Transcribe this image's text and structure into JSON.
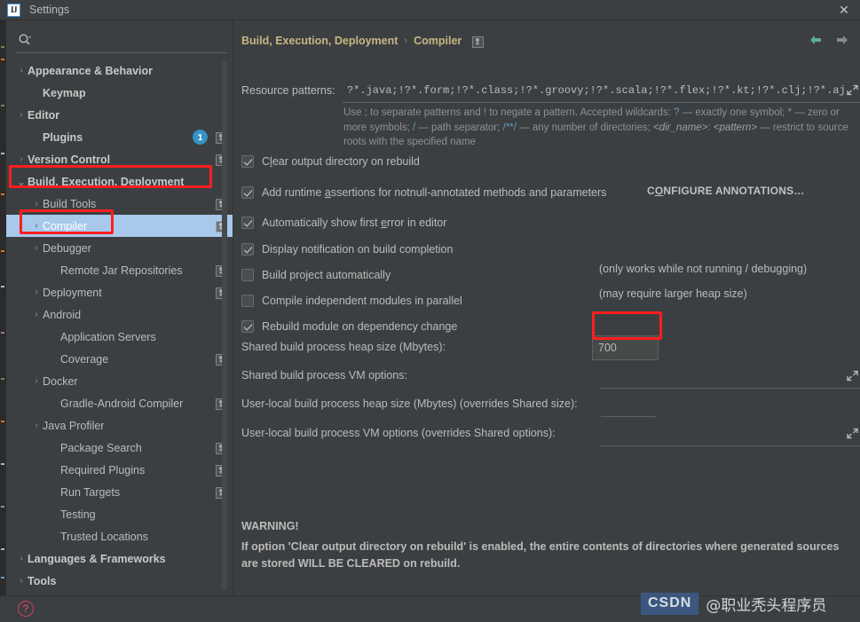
{
  "window": {
    "title": "Settings",
    "logo_text": "IJ",
    "close_label": "✕"
  },
  "sidebar": {
    "search": {
      "placeholder": "",
      "value": "",
      "icon": "search-icon"
    },
    "items": [
      {
        "label": "Appearance & Behavior",
        "indent": 0,
        "arrow": "›",
        "bold": true,
        "badge": false,
        "selected": false
      },
      {
        "label": "Keymap",
        "indent": 1,
        "arrow": "",
        "bold": true,
        "badge": false,
        "selected": false
      },
      {
        "label": "Editor",
        "indent": 0,
        "arrow": "›",
        "bold": true,
        "badge": false,
        "selected": false
      },
      {
        "label": "Plugins",
        "indent": 1,
        "arrow": "",
        "bold": true,
        "badge": true,
        "selected": false,
        "count": "1"
      },
      {
        "label": "Version Control",
        "indent": 0,
        "arrow": "›",
        "bold": true,
        "badge": true,
        "selected": false
      },
      {
        "label": "Build, Execution, Deployment",
        "indent": 0,
        "arrow": "⌄",
        "bold": true,
        "badge": false,
        "selected": false,
        "annotated": true
      },
      {
        "label": "Build Tools",
        "indent": 2,
        "arrow": "›",
        "bold": false,
        "badge": true,
        "selected": false
      },
      {
        "label": "Compiler",
        "indent": 2,
        "arrow": "›",
        "bold": false,
        "badge": true,
        "selected": true,
        "annotated": true
      },
      {
        "label": "Debugger",
        "indent": 2,
        "arrow": "›",
        "bold": false,
        "badge": false,
        "selected": false
      },
      {
        "label": "Remote Jar Repositories",
        "indent": 3,
        "arrow": "",
        "bold": false,
        "badge": true,
        "selected": false
      },
      {
        "label": "Deployment",
        "indent": 2,
        "arrow": "›",
        "bold": false,
        "badge": true,
        "selected": false
      },
      {
        "label": "Android",
        "indent": 2,
        "arrow": "›",
        "bold": false,
        "badge": false,
        "selected": false
      },
      {
        "label": "Application Servers",
        "indent": 3,
        "arrow": "",
        "bold": false,
        "badge": false,
        "selected": false
      },
      {
        "label": "Coverage",
        "indent": 3,
        "arrow": "",
        "bold": false,
        "badge": true,
        "selected": false
      },
      {
        "label": "Docker",
        "indent": 2,
        "arrow": "›",
        "bold": false,
        "badge": false,
        "selected": false
      },
      {
        "label": "Gradle-Android Compiler",
        "indent": 3,
        "arrow": "",
        "bold": false,
        "badge": true,
        "selected": false
      },
      {
        "label": "Java Profiler",
        "indent": 2,
        "arrow": "›",
        "bold": false,
        "badge": false,
        "selected": false
      },
      {
        "label": "Package Search",
        "indent": 3,
        "arrow": "",
        "bold": false,
        "badge": true,
        "selected": false
      },
      {
        "label": "Required Plugins",
        "indent": 3,
        "arrow": "",
        "bold": false,
        "badge": true,
        "selected": false
      },
      {
        "label": "Run Targets",
        "indent": 3,
        "arrow": "",
        "bold": false,
        "badge": true,
        "selected": false
      },
      {
        "label": "Testing",
        "indent": 3,
        "arrow": "",
        "bold": false,
        "badge": false,
        "selected": false
      },
      {
        "label": "Trusted Locations",
        "indent": 3,
        "arrow": "",
        "bold": false,
        "badge": false,
        "selected": false
      },
      {
        "label": "Languages & Frameworks",
        "indent": 0,
        "arrow": "›",
        "bold": true,
        "badge": false,
        "selected": false
      },
      {
        "label": "Tools",
        "indent": 0,
        "arrow": "›",
        "bold": true,
        "badge": false,
        "selected": false
      }
    ]
  },
  "main": {
    "breadcrumb": {
      "parent": "Build, Execution, Deployment",
      "separator": "›",
      "current": "Compiler"
    },
    "nav": {
      "back": "back-arrow",
      "forward": "forward-arrow"
    },
    "resource_patterns": {
      "label": "Resource patterns:",
      "value": "?*.java;!?*.form;!?*.class;!?*.groovy;!?*.scala;!?*.flex;!?*.kt;!?*.clj;!?*.aj",
      "hint": {
        "t1": "Use ",
        "h1": ";",
        "t2": " to separate patterns and ",
        "h2": "!",
        "t3": " to negate a pattern. Accepted wildcards: ",
        "h3": "?",
        "t4": " — exactly one symbol; ",
        "h4": "*",
        "t5": " — zero or more symbols; ",
        "h5": "/",
        "t6": " — path separator; ",
        "h6": "/**/",
        "t7": " — any number of directories;  ",
        "i1": "<dir_name>",
        "t8": ": ",
        "i2": "<pattern>",
        "t9": " — restrict to source roots with the specified name"
      }
    },
    "checkboxes": [
      {
        "label_pre": "C",
        "label_mnemonic": "l",
        "label_post": "ear output directory on rebuild",
        "checked": true
      },
      {
        "label_pre": "Add runtime ",
        "label_mnemonic": "a",
        "label_post": "ssertions for notnull-annotated methods and parameters",
        "checked": true
      },
      {
        "label_pre": "Automatically show first ",
        "label_mnemonic": "e",
        "label_post": "rror in editor",
        "checked": true
      },
      {
        "label_pre": "Display notification on build completion",
        "label_mnemonic": "",
        "label_post": "",
        "checked": true
      },
      {
        "label_pre": "Build project automatically",
        "label_mnemonic": "",
        "label_post": "",
        "checked": false
      },
      {
        "label_pre": "Compile independent modules in parallel",
        "label_mnemonic": "",
        "label_post": "",
        "checked": false
      },
      {
        "label_pre": "Rebuild module on dependency change",
        "label_mnemonic": "",
        "label_post": "",
        "checked": true
      }
    ],
    "configure_annotations": {
      "pre": "C",
      "mnemonic": "O",
      "post": "NFIGURE ANNOTATIONS…"
    },
    "note_build_auto": "(only works while not running / debugging)",
    "note_parallel": "(may require larger heap size)",
    "fields": [
      {
        "label": "Shared build process heap size (Mbytes):",
        "value": "700",
        "boxed": true,
        "annotated": true
      },
      {
        "label": "Shared build process VM options:",
        "value": "",
        "boxed": false,
        "expand": true
      },
      {
        "label": "User-local build process heap size (Mbytes) (overrides Shared size):",
        "value": "",
        "boxed": false,
        "expand": false,
        "short": true
      },
      {
        "label": "User-local build process VM options (overrides Shared options):",
        "value": "",
        "boxed": false,
        "expand": true
      }
    ],
    "warning": {
      "title": "WARNING!",
      "body": "If option 'Clear output directory on rebuild' is enabled, the entire contents of directories where generated sources are stored WILL BE CLEARED on rebuild."
    }
  },
  "footer": {
    "help_label": "?"
  },
  "watermark": {
    "logo": "CSDN",
    "user": "@职业秃头程序员"
  },
  "colors": {
    "bg": "#3c3f41",
    "selection": "#a8c8ec",
    "breadcrumb": "#c9b583",
    "annotation": "#ff1e1e",
    "badge_blue": "#3592c4",
    "hint_highlight": "#6897bb",
    "help_red": "#cf3f5c",
    "nav_back": "#5fa8a0"
  }
}
